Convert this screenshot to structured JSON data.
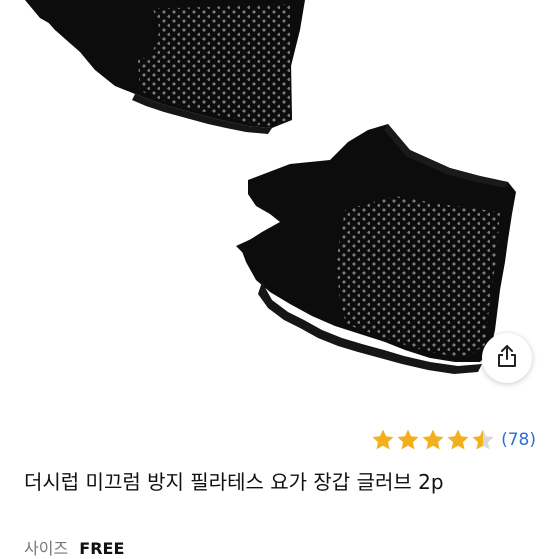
{
  "product": {
    "image_alt": "black fingerless yoga gloves pair",
    "rating": 4.5,
    "review_count": "(78)",
    "title": "더시럽 미끄럼 방지 필라테스 요가 장갑 글러브 2p",
    "size_label": "사이즈",
    "size_value": "FREE"
  },
  "colors": {
    "star": "#f2b01e",
    "star_empty": "#d9d9d9",
    "link": "#2d6fd6",
    "glove": "#0c0c0c",
    "grip_dot": "#7a7a7a"
  },
  "icons": {
    "share": "share-icon",
    "star": "star-icon"
  }
}
